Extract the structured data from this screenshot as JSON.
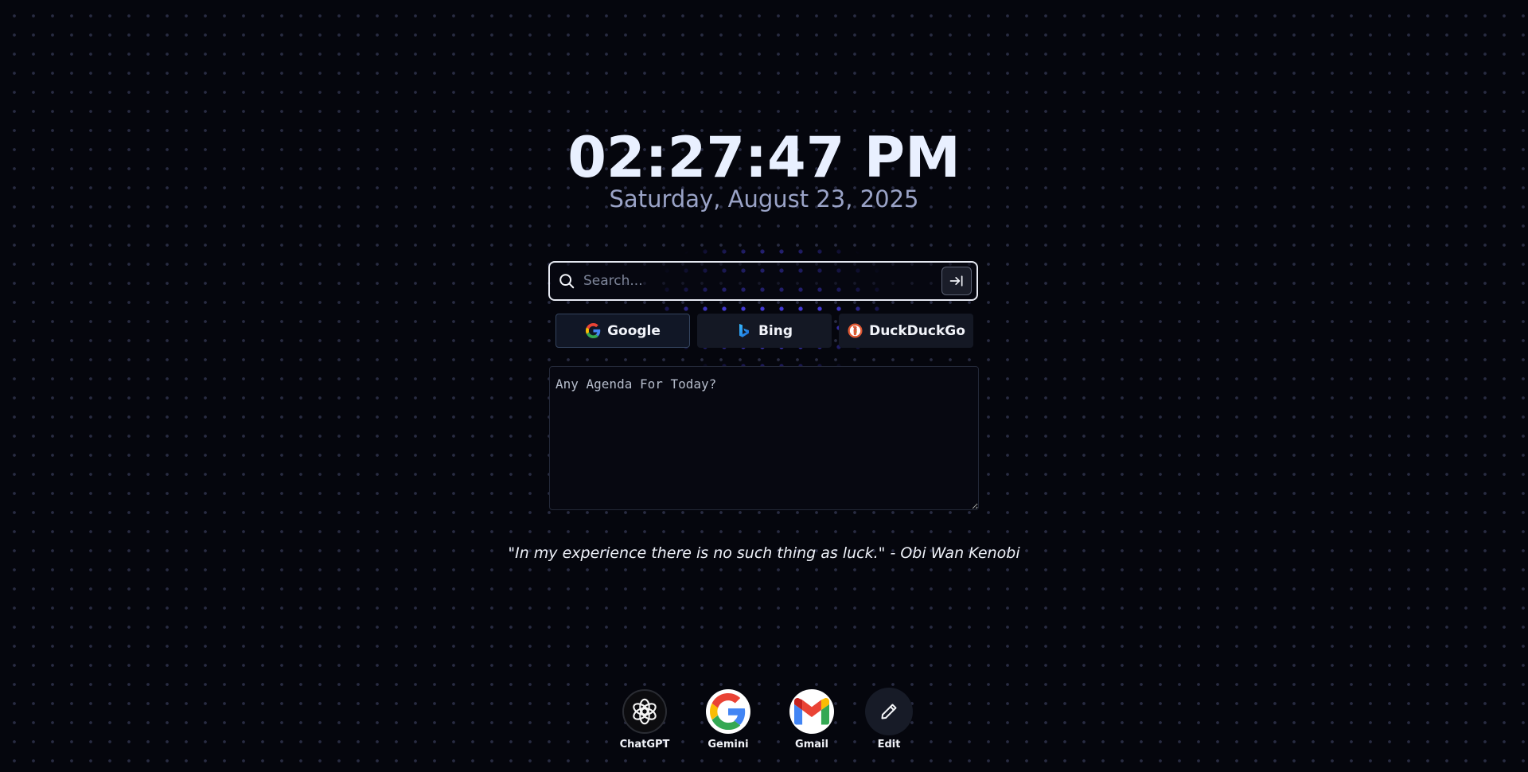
{
  "clock": {
    "time": "02:27:47 PM",
    "date": "Saturday, August 23, 2025"
  },
  "search": {
    "placeholder": "Search...",
    "value": "",
    "icon": "search-icon",
    "submit_icon": "arrow-right-to-line-icon"
  },
  "engines": [
    {
      "label": "Google",
      "icon": "google-icon",
      "active": true
    },
    {
      "label": "Bing",
      "icon": "bing-icon",
      "active": false
    },
    {
      "label": "DuckDuckGo",
      "icon": "duckduckgo-icon",
      "active": false
    }
  ],
  "agenda": {
    "placeholder": "Any Agenda For Today?",
    "value": ""
  },
  "quote": {
    "text": "\"In my experience there is no such thing as luck.\" - Obi Wan Kenobi"
  },
  "shortcuts": [
    {
      "label": "ChatGPT",
      "icon": "chatgpt-icon"
    },
    {
      "label": "Gemini",
      "icon": "google-g-icon"
    },
    {
      "label": "Gmail",
      "icon": "gmail-icon"
    },
    {
      "label": "Edit",
      "icon": "pencil-icon"
    }
  ],
  "colors": {
    "background": "#05060d",
    "accent_glow": "#463cdc",
    "text_primary": "#e9f0ff",
    "text_secondary": "#9aa3c7"
  }
}
